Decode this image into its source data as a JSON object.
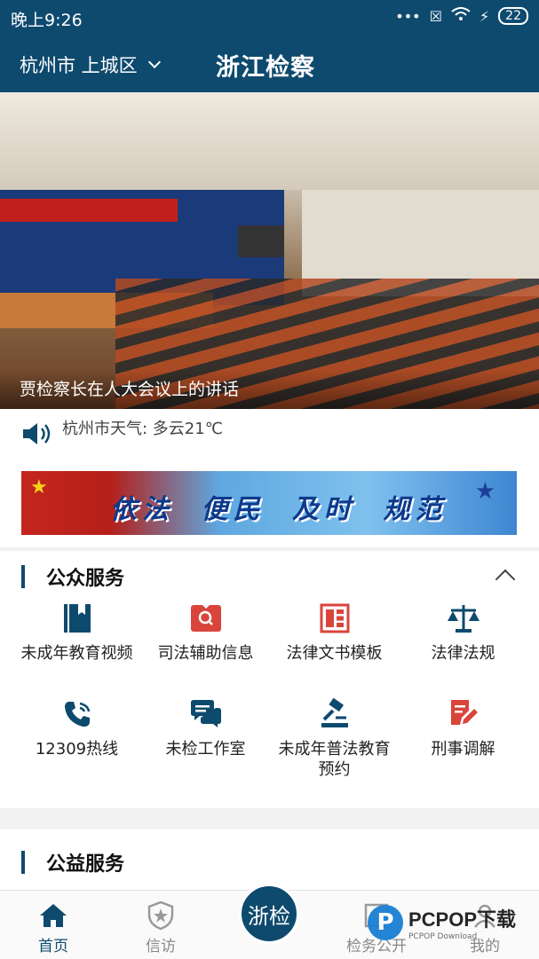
{
  "status": {
    "time": "晚上9:26",
    "battery": "22"
  },
  "header": {
    "location": "杭州市 上城区",
    "title": "浙江检察"
  },
  "banner": {
    "caption": "贾检察长在人大会议上的讲话"
  },
  "weather": {
    "text": "杭州市天气: 多云21℃"
  },
  "slogan": {
    "text": "依法 便民 及时 规范"
  },
  "public_services": {
    "title": "公众服务",
    "items": [
      {
        "label": "未成年教育视频",
        "icon": "book-icon",
        "color": "#0e4a6e"
      },
      {
        "label": "司法辅助信息",
        "icon": "search-doc-icon",
        "color": "#d9453b"
      },
      {
        "label": "法律文书模板",
        "icon": "template-icon",
        "color": "#d9453b"
      },
      {
        "label": "法律法规",
        "icon": "scales-icon",
        "color": "#0e4a6e"
      },
      {
        "label": "12309热线",
        "icon": "phone-icon",
        "color": "#0e4a6e"
      },
      {
        "label": "未检工作室",
        "icon": "chat-icon",
        "color": "#0e4a6e"
      },
      {
        "label": "未成年普法教育预约",
        "icon": "gavel-icon",
        "color": "#0e4a6e"
      },
      {
        "label": "刑事调解",
        "icon": "edit-doc-icon",
        "color": "#d9453b"
      }
    ]
  },
  "welfare": {
    "title": "公益服务"
  },
  "nav": {
    "home": "首页",
    "petition": "信访",
    "center": "浙检",
    "affairs": "检务公开",
    "mine": "我的"
  },
  "watermark": {
    "brand": "PCPOP下载",
    "sub": "PCPOP Download"
  }
}
